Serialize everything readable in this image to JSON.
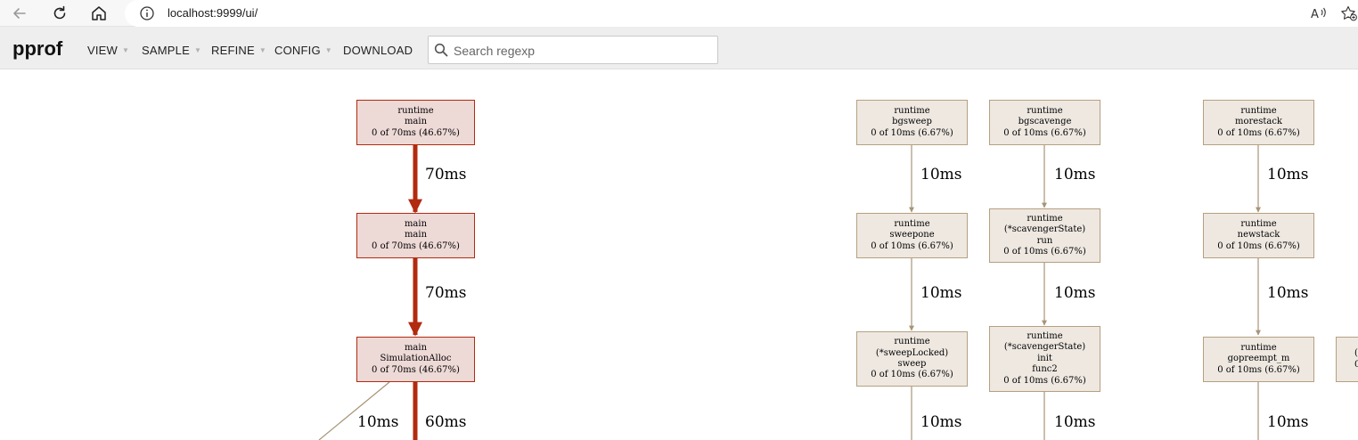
{
  "browser": {
    "url": "localhost:9999/ui/"
  },
  "header": {
    "logo": "pprof",
    "menus": [
      "VIEW",
      "SAMPLE",
      "REFINE",
      "CONFIG",
      "DOWNLOAD"
    ],
    "search_placeholder": "Search regexp"
  },
  "graph": {
    "nodes": [
      {
        "lines": [
          "runtime",
          "main",
          "0 of 70ms (46.67%)"
        ],
        "style": "hot"
      },
      {
        "lines": [
          "main",
          "main",
          "0 of 70ms (46.67%)"
        ],
        "style": "hot"
      },
      {
        "lines": [
          "main",
          "SimulationAlloc",
          "0 of 70ms (46.67%)"
        ],
        "style": "hot"
      },
      {
        "lines": [
          "runtime",
          "bgsweep",
          "0 of 10ms (6.67%)"
        ],
        "style": "cool"
      },
      {
        "lines": [
          "runtime",
          "sweepone",
          "0 of 10ms (6.67%)"
        ],
        "style": "cool"
      },
      {
        "lines": [
          "runtime",
          "(*sweepLocked)",
          "sweep",
          "0 of 10ms (6.67%)"
        ],
        "style": "cool"
      },
      {
        "lines": [
          "runtime",
          "bgscavenge",
          "0 of 10ms (6.67%)"
        ],
        "style": "cool"
      },
      {
        "lines": [
          "runtime",
          "(*scavengerState)",
          "run",
          "0 of 10ms (6.67%)"
        ],
        "style": "cool"
      },
      {
        "lines": [
          "runtime",
          "(*scavengerState)",
          "init",
          "func2",
          "0 of 10ms (6.67%)"
        ],
        "style": "cool"
      },
      {
        "lines": [
          "runtime",
          "morestack",
          "0 of 10ms (6.67%)"
        ],
        "style": "cool"
      },
      {
        "lines": [
          "runtime",
          "newstack",
          "0 of 10ms (6.67%)"
        ],
        "style": "cool"
      },
      {
        "lines": [
          "runtime",
          "gopreempt_m",
          "0 of 10ms (6.67%)"
        ],
        "style": "cool"
      },
      {
        "lines": [
          "(",
          "0"
        ],
        "style": "cool"
      }
    ],
    "edge_labels": [
      "70ms",
      "70ms",
      "10ms",
      "60ms",
      "10ms",
      "10ms",
      "10ms",
      "10ms",
      "10ms",
      "10ms",
      "10ms",
      "10ms",
      "10ms"
    ]
  }
}
